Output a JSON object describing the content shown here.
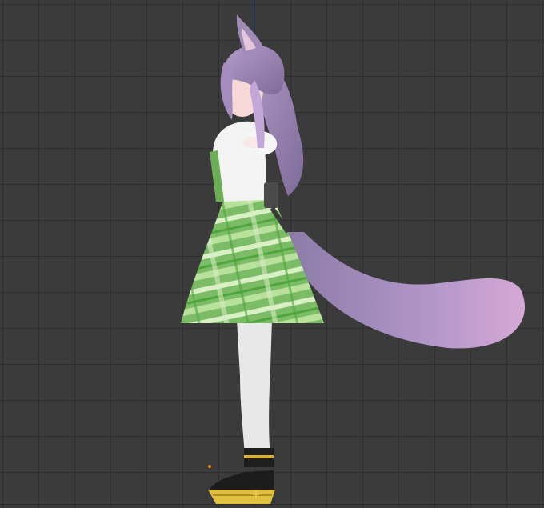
{
  "viewport": {
    "background_color": "#3b3b3b",
    "grid_color": "#2f2f2f",
    "z_axis_color": "#3f6fb0",
    "origin_marker_color": "#e08a1e"
  },
  "model": {
    "hair_color": "#9a86b0",
    "tail_color": "#b596c6",
    "skirt_color": "#7fc06a",
    "blouse_color": "#f2f2f2",
    "leggings_color": "#e6e6e6",
    "shoe_color": "#1f1f1f",
    "sole_color": "#e0c040"
  }
}
